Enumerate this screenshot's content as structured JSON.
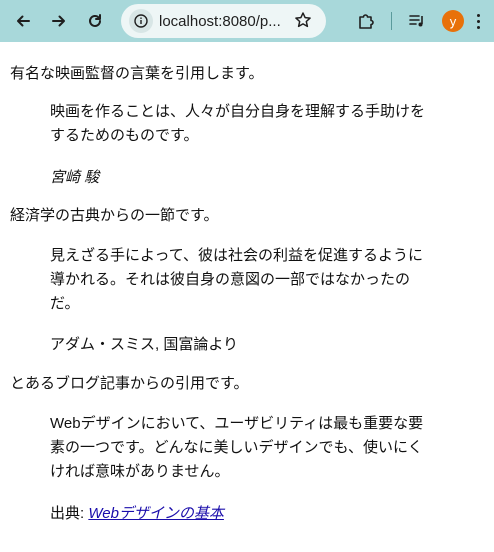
{
  "browser": {
    "url": "localhost:8080/p...",
    "profile_initial": "y",
    "icons": [
      "back-arrow-icon",
      "forward-arrow-icon",
      "reload-icon",
      "site-info-icon",
      "bookmark-star-icon",
      "extensions-icon",
      "media-queue-icon",
      "more-menu-icon"
    ]
  },
  "sections": [
    {
      "intro": "有名な映画監督の言葉を引用します。",
      "quote_lines": [
        "映画を作ることは、人々が自分自身を理解する手助けを",
        "するためのものです。"
      ],
      "attribution": "宮崎 駿"
    },
    {
      "intro": "経済学の古典からの一節です。",
      "quote_lines": [
        "見えざる手によって、彼は社会の利益を促進するように",
        "導かれる。それは彼自身の意図の一部ではなかったの",
        "だ。"
      ],
      "attribution": "アダム・スミス, 国富論より"
    },
    {
      "intro": "とあるブログ記事からの引用です。",
      "quote_lines": [
        "Webデザインにおいて、ユーザビリティは最も重要な要",
        "素の一つです。どんなに美しいデザインでも、使いにく",
        "ければ意味がありません。"
      ],
      "source_label": "出典: ",
      "source_link": "Webデザインの基本"
    }
  ]
}
